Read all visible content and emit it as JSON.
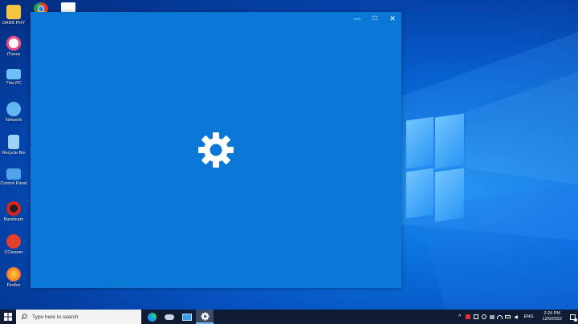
{
  "desktop": {
    "icons": [
      {
        "label": "DANS PHY",
        "icon": "folder-user-icon",
        "color": "#f5c542"
      },
      {
        "label": "iTunes",
        "icon": "itunes-icon",
        "color": "#ef4a7b"
      },
      {
        "label": "This PC",
        "icon": "computer-icon",
        "color": "#6ec0f5"
      },
      {
        "label": "Network",
        "icon": "network-icon",
        "color": "#5fb6f2"
      },
      {
        "label": "Recycle Bin",
        "icon": "recycle-bin-icon",
        "color": "#9ed3f7"
      },
      {
        "label": "Control Panel",
        "icon": "control-panel-icon",
        "color": "#4fa3e6"
      },
      {
        "label": "Bandicam",
        "icon": "bandicam-icon",
        "color": "#d7261f"
      },
      {
        "label": "CCleaner",
        "icon": "ccleaner-icon",
        "color": "#e0402c"
      },
      {
        "label": "Firefox",
        "icon": "firefox-icon",
        "color": "#ff8a1f"
      }
    ]
  },
  "window": {
    "title": "Settings",
    "minimize": "—",
    "maximize": "☐",
    "close": "✕",
    "background": "#0b78d7"
  },
  "taskbar": {
    "search_placeholder": "Type here to search",
    "language": "ENG",
    "time": "2:24 PM",
    "date": "12/9/2022",
    "background": "#0f1c33"
  }
}
